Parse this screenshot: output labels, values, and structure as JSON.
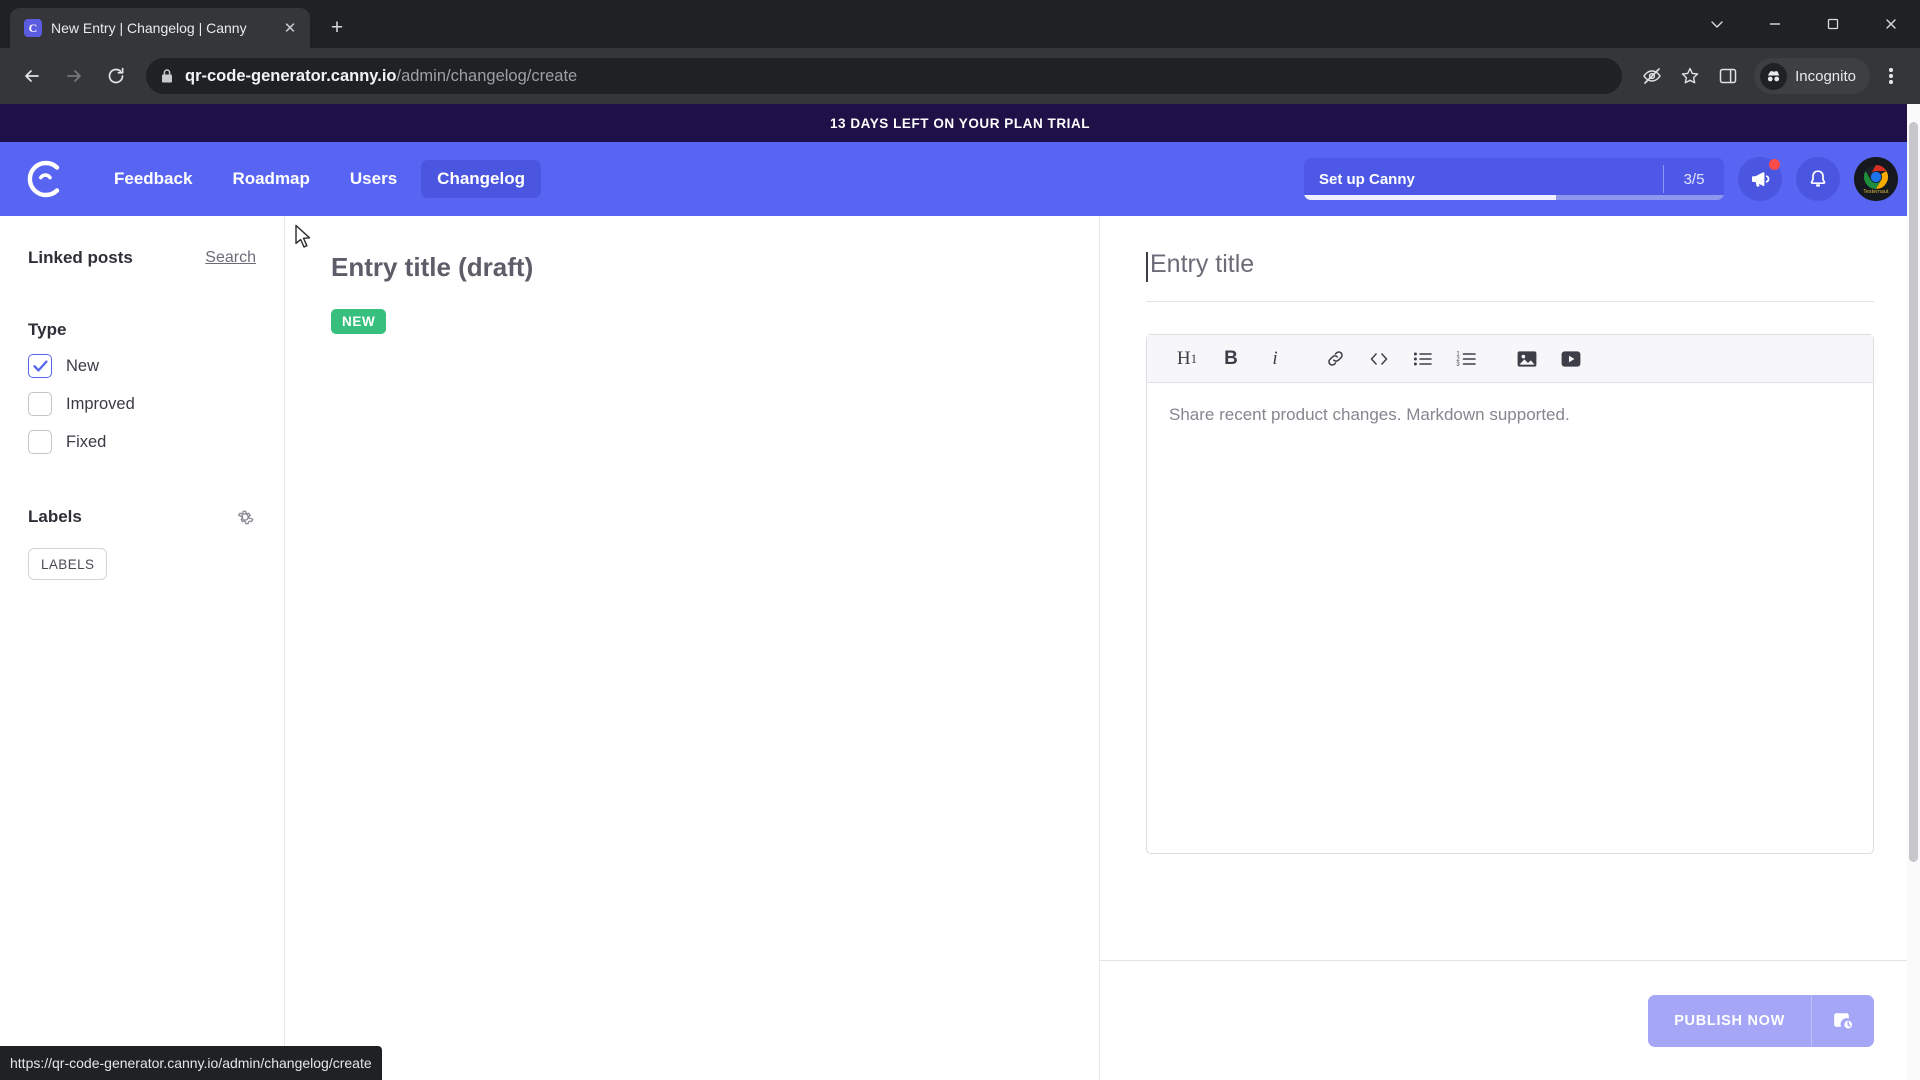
{
  "browser": {
    "tab": {
      "title": "New Entry | Changelog | Canny",
      "favicon_letter": "C",
      "close_label": "✕"
    },
    "new_tab_label": "+",
    "window_controls": {
      "minimize": "minimize-icon",
      "maximize": "maximize-icon",
      "close": "close-icon",
      "tab_search": "tab-search-icon"
    },
    "back_label": "back-icon",
    "forward_label": "forward-icon",
    "reload_label": "reload-icon",
    "url_host": "qr-code-generator.canny.io",
    "url_path": "/admin/changelog/create",
    "profile_label": "Incognito",
    "icons": {
      "lock": "lock-icon",
      "no_eye": "hide-tracking-icon",
      "star": "bookmark-star-icon",
      "sidepanel": "side-panel-icon",
      "menu": "kebab-menu-icon"
    },
    "status_url": "https://qr-code-generator.canny.io/admin/changelog/create"
  },
  "banner": {
    "text": "13 DAYS LEFT ON YOUR PLAN TRIAL",
    "bg": "#1f1147"
  },
  "nav": {
    "brand": "canny-logo",
    "links": [
      {
        "label": "Feedback",
        "active": false
      },
      {
        "label": "Roadmap",
        "active": false
      },
      {
        "label": "Users",
        "active": false
      },
      {
        "label": "Changelog",
        "active": true
      }
    ],
    "setup": {
      "label": "Set up Canny",
      "count": "3/5",
      "progress_percent": 60
    },
    "megaphone": "megaphone-icon",
    "bell": "bell-icon",
    "avatar_text": "Testernaut",
    "accent": "#5865f2"
  },
  "sidebar": {
    "linked_posts_title": "Linked posts",
    "search_label": "Search",
    "type_title": "Type",
    "types": [
      {
        "label": "New",
        "checked": true
      },
      {
        "label": "Improved",
        "checked": false
      },
      {
        "label": "Fixed",
        "checked": false
      }
    ],
    "labels_title": "Labels",
    "labels_gear": "gear-icon",
    "labels_chip": "LABELS"
  },
  "preview": {
    "title": "Entry title (draft)",
    "badge": "NEW",
    "badge_color": "#37c07d"
  },
  "editor": {
    "title_placeholder": "Entry title",
    "title_value": "",
    "toolbar": [
      {
        "name": "heading-icon",
        "glyph": "H1"
      },
      {
        "name": "bold-icon",
        "glyph": "B"
      },
      {
        "name": "italic-icon",
        "glyph": "i"
      },
      {
        "name": "link-icon",
        "glyph": "🔗"
      },
      {
        "name": "code-icon",
        "glyph": "<>"
      },
      {
        "name": "bulleted-list-icon",
        "glyph": "☰"
      },
      {
        "name": "numbered-list-icon",
        "glyph": "1."
      },
      {
        "name": "image-icon",
        "glyph": "🖼"
      },
      {
        "name": "video-icon",
        "glyph": "▶"
      }
    ],
    "body_placeholder": "Share recent product changes. Markdown supported.",
    "body_value": "",
    "publish_label": "PUBLISH NOW",
    "schedule_icon": "schedule-icon",
    "publish_color": "#a5a6f6"
  }
}
